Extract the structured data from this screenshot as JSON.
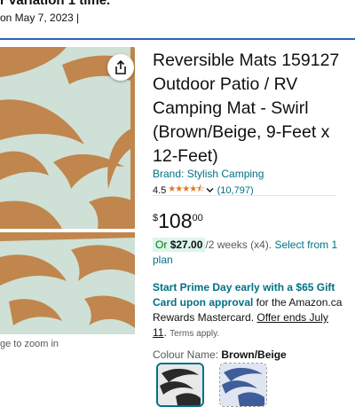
{
  "header": {
    "variation_text": "r variation 1 time.",
    "date_text": "on May 7, 2023 |"
  },
  "gallery": {
    "zoom_hint": "ge to zoom in",
    "share_icon": "share-icon"
  },
  "product": {
    "title": "Reversible Mats 159127 Outdoor Patio / RV Camping Mat - Swirl (Brown/Beige, 9-Feet x 12-Feet)",
    "brand": "Brand: Stylish Camping",
    "rating_value": "4.5",
    "rating_stars": "★★★★⯪",
    "rating_count": "(10,797)"
  },
  "price": {
    "currency": "$",
    "whole": "108",
    "fraction": "00"
  },
  "installment": {
    "or_label": "Or",
    "amount": "$27.00",
    "period": "/2 weeks (x4).",
    "select_link": "Select from 1 plan"
  },
  "promo": {
    "headline": "Start Prime Day early with a $65 Gift Card upon approval",
    "body": " for the Amazon.ca Rewards Mastercard. ",
    "offer_link": "Offer ends July 11",
    "period": ".",
    "terms": "Terms apply."
  },
  "colour": {
    "label": "Colour Name: ",
    "value": "Brown/Beige"
  },
  "colors": {
    "link": "#007185",
    "star": "#de7921",
    "divider_blue": "#2f64b8",
    "highlight": "#dcf5ed",
    "mat_brown": "#c0864d",
    "mat_beige": "#cfe0d6"
  }
}
